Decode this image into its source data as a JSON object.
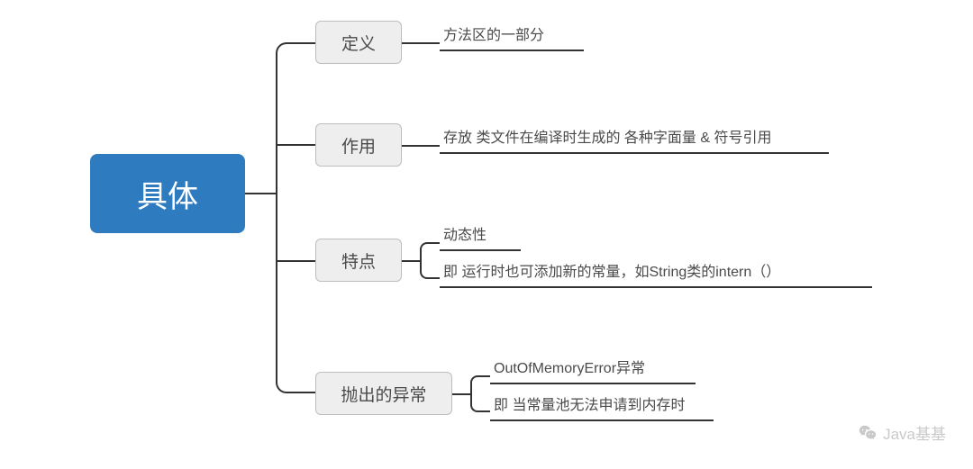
{
  "root": {
    "label": "具体"
  },
  "children": [
    {
      "label": "定义",
      "leaves": [
        "方法区的一部分"
      ]
    },
    {
      "label": "作用",
      "leaves": [
        "存放 类文件在编译时生成的 各种字面量 & 符号引用"
      ]
    },
    {
      "label": "特点",
      "leaves": [
        "动态性",
        "即 运行时也可添加新的常量，如String类的intern（）"
      ]
    },
    {
      "label": "抛出的异常",
      "leaves": [
        "OutOfMemoryError异常",
        "即 当常量池无法申请到内存时"
      ]
    }
  ],
  "watermark": "Java基基"
}
